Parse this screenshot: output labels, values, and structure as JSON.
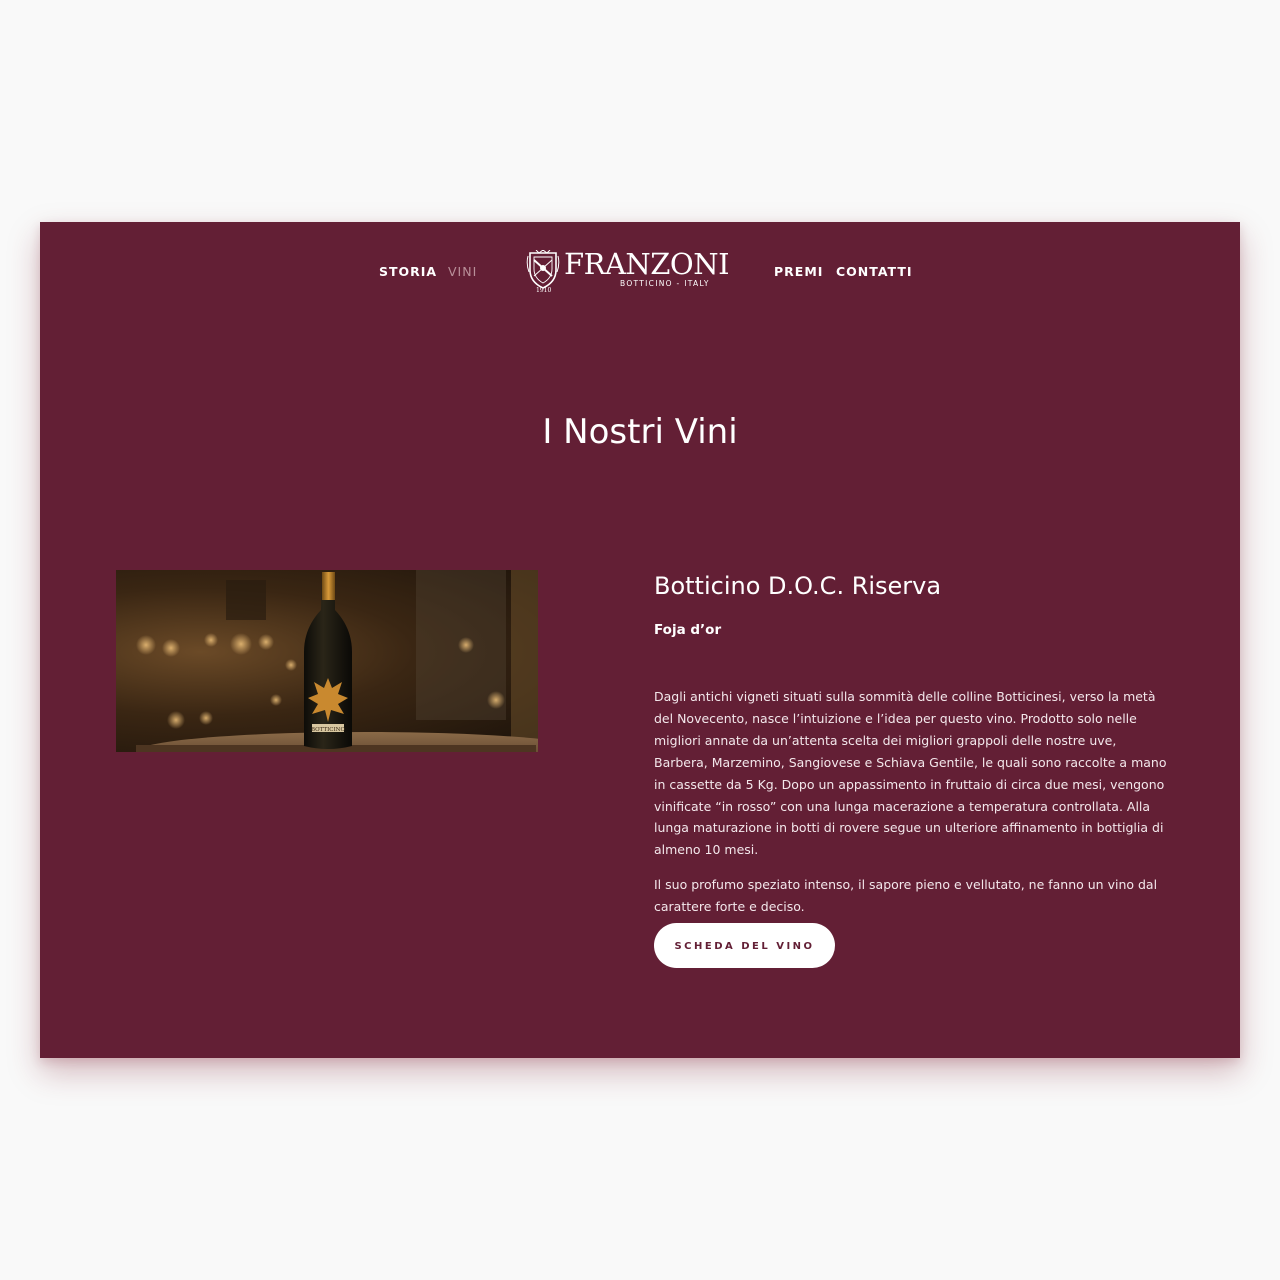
{
  "nav": {
    "left_items": [
      {
        "label": "STORIA",
        "active": false
      },
      {
        "label": "VINI",
        "active": true
      }
    ],
    "right_items": [
      {
        "label": "PREMI",
        "active": false
      },
      {
        "label": "CONTATTI",
        "active": false
      }
    ]
  },
  "logo": {
    "brand": "FRANZONI",
    "tagline": "BOTTICINO - ITALY",
    "year": "1910",
    "icon": "crest-icon"
  },
  "page": {
    "title": "I Nostri Vini"
  },
  "product": {
    "image_icon": "wine-bottle-photo",
    "bottle_label": "BOTTICINO",
    "name": "Botticino D.O.C. Riserva",
    "subtitle": "Foja d’or",
    "description": [
      "Dagli antichi vigneti situati sulla sommità delle colline Botticinesi, verso la metà del Novecento, nasce l’intuizione e l’idea per questo vino. Prodotto solo nelle migliori annate da un’attenta scelta dei migliori grappoli delle nostre uve, Barbera, Marzemino, Sangiovese e Schiava Gentile, le quali sono raccolte a mano in cassette da 5 Kg. Dopo un appassimento in fruttaio di circa due mesi, vengono vinificate “in rosso” con una lunga macerazione a temperatura controllata. Alla lunga maturazione in botti di rovere segue un ulteriore affinamento in bottiglia di almeno 10 mesi.",
      "Il suo profumo speziato intenso, il sapore pieno e vellutato, ne fanno un vino dal carattere forte e deciso."
    ],
    "button_label": "SCHEDA DEL VINO"
  },
  "colors": {
    "background": "#f9f9f9",
    "brand_burgundy": "#631f35",
    "text": "#ffffff",
    "nav_active": "#b98f99",
    "button_bg": "#ffffff"
  }
}
